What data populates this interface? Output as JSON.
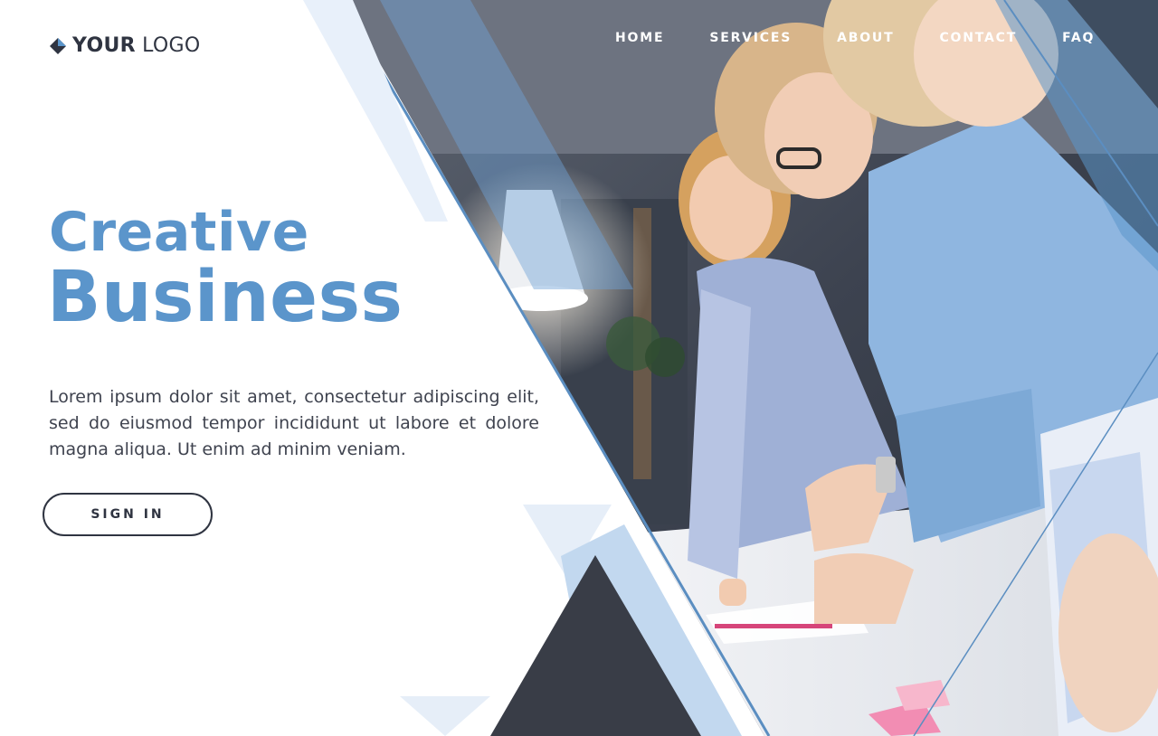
{
  "brand": {
    "logo_bold": "YOUR",
    "logo_light": "LOGO"
  },
  "nav": {
    "items": [
      "HOME",
      "SERVICES",
      "ABOUT",
      "CONTACT",
      "FAQ"
    ]
  },
  "hero": {
    "title_line1": "Creative",
    "title_line2": "Business",
    "description": "Lorem ipsum dolor sit amet, consectetur adipiscing elit, sed do eiusmod tempor incididunt ut labore et dolore magna aliqua. Ut enim ad minim veniam.",
    "cta_label": "SIGN IN"
  },
  "colors": {
    "accent": "#5b95cb",
    "dark": "#2f3441",
    "pale_blue": "#e8f0fa",
    "light_blue": "#c2d8ef"
  }
}
